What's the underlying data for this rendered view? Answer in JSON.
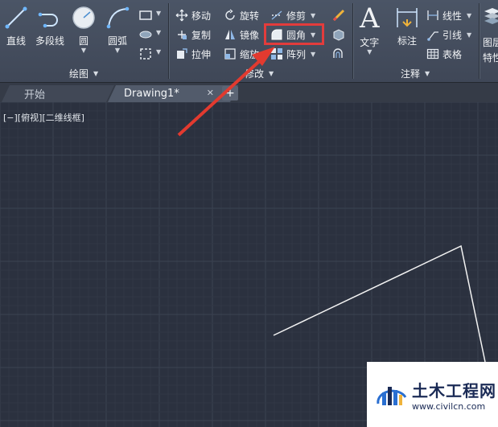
{
  "ribbon": {
    "draw_panel": {
      "title": "绘图",
      "line": "直线",
      "polyline": "多段线",
      "circle": "圆",
      "arc": "圆弧"
    },
    "modify_panel": {
      "title": "修改",
      "move": "移动",
      "rotate": "旋转",
      "trim": "修剪",
      "copy": "复制",
      "mirror": "镜像",
      "fillet": "圆角",
      "stretch": "拉伸",
      "scale": "缩放",
      "array": "阵列"
    },
    "annotation_panel": {
      "title": "注释",
      "text": "文字",
      "dimension": "标注",
      "linear": "线性",
      "leader": "引线",
      "table": "表格"
    },
    "layers_panel": {
      "layer_line1": "图层",
      "layer_line2": "特性"
    }
  },
  "tabs": {
    "start": "开始",
    "drawing": "Drawing1*",
    "add": "+"
  },
  "viewport": {
    "label": "[−][俯视][二维线框]"
  },
  "watermark": {
    "title": "土木工程网",
    "url": "www.civilcn.com"
  },
  "colors": {
    "canvas_bg": "#2b313f",
    "highlight": "#e33c3c",
    "arrow": "#e23a2f"
  }
}
